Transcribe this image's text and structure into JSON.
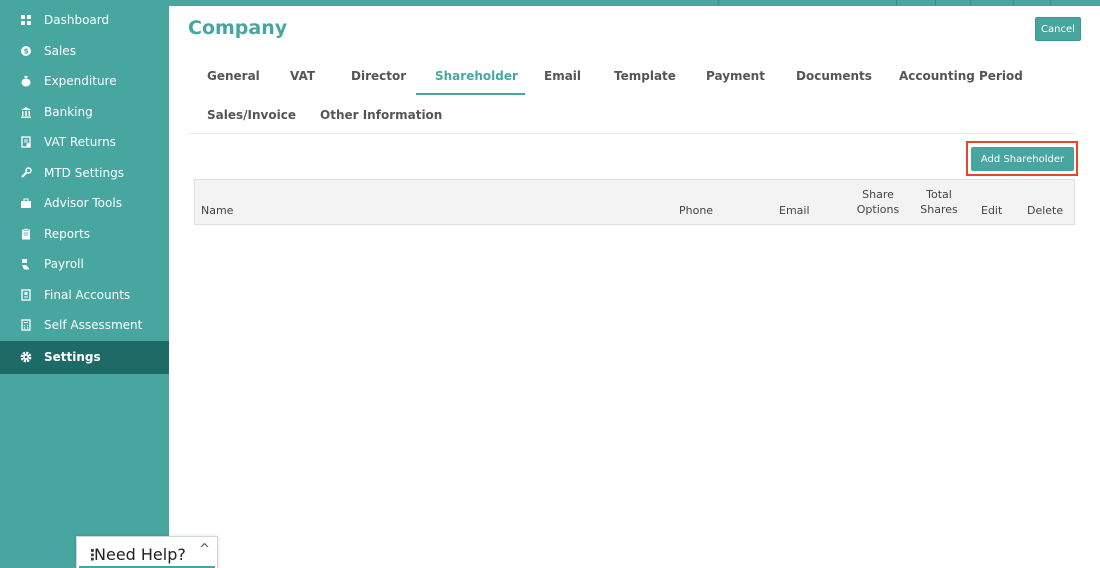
{
  "sidebar": {
    "items": [
      {
        "label": "Dashboard",
        "icon": "grid-icon"
      },
      {
        "label": "Sales",
        "icon": "coins-icon"
      },
      {
        "label": "Expenditure",
        "icon": "money-bag-icon"
      },
      {
        "label": "Banking",
        "icon": "bank-icon"
      },
      {
        "label": "VAT Returns",
        "icon": "receipt-icon"
      },
      {
        "label": "MTD Settings",
        "icon": "wrench-icon"
      },
      {
        "label": "Advisor Tools",
        "icon": "briefcase-icon"
      },
      {
        "label": "Reports",
        "icon": "report-icon"
      },
      {
        "label": "Payroll",
        "icon": "hand-money-icon"
      },
      {
        "label": "Final Accounts",
        "icon": "document-icon"
      },
      {
        "label": "Self Assessment",
        "icon": "calculator-icon"
      },
      {
        "label": "Settings",
        "icon": "gear-icon"
      }
    ],
    "active": "Settings"
  },
  "help": {
    "label": "Need Help?"
  },
  "page": {
    "title": "Company",
    "cancel_label": "Cancel"
  },
  "tabs": [
    {
      "label": "General"
    },
    {
      "label": "VAT"
    },
    {
      "label": "Director"
    },
    {
      "label": "Shareholder"
    },
    {
      "label": "Email"
    },
    {
      "label": "Template"
    },
    {
      "label": "Payment"
    },
    {
      "label": "Documents"
    },
    {
      "label": "Accounting Period"
    },
    {
      "label": "Sales/Invoice"
    },
    {
      "label": "Other Information"
    }
  ],
  "active_tab": "Shareholder",
  "shareholders": {
    "add_label": "Add Shareholder",
    "columns": {
      "name": "Name",
      "phone": "Phone",
      "email": "Email",
      "share_options_1": "Share",
      "share_options_2": "Options",
      "total_shares_1": "Total",
      "total_shares_2": "Shares",
      "edit": "Edit",
      "delete": "Delete"
    },
    "rows": []
  },
  "colors": {
    "accent": "#47a7a0",
    "sidebar_active": "#1e6a66",
    "highlight": "#e8452a"
  }
}
